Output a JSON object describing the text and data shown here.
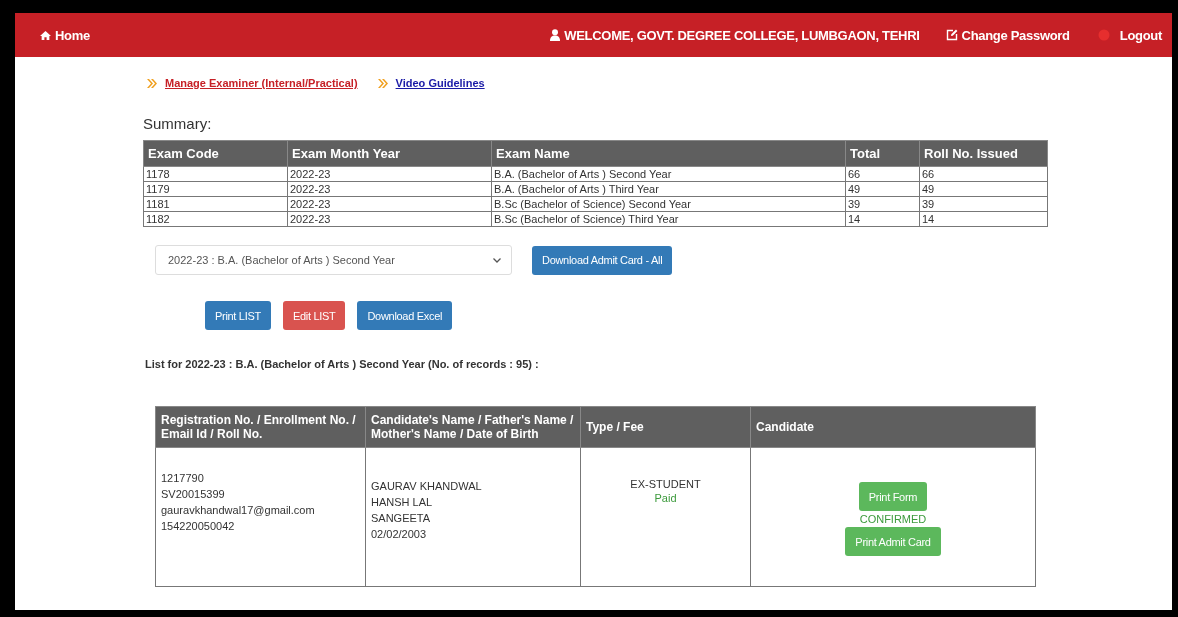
{
  "navbar": {
    "home": "Home",
    "welcome": "WELCOME, GOVT. DEGREE COLLEGE, LUMBGAON, TEHRI",
    "change_password": "Change Password",
    "logout": "Logout"
  },
  "links": [
    {
      "label": "Manage Examiner (Internal/Practical)",
      "kind": "danger"
    },
    {
      "label": "Video Guidelines",
      "kind": "primary"
    }
  ],
  "summary": {
    "title": "Summary:",
    "columns": [
      "Exam Code",
      "Exam Month Year",
      "Exam Name",
      "Total",
      "Roll No. Issued"
    ],
    "rows": [
      [
        "1178",
        "2022-23",
        "B.A. (Bachelor of Arts ) Second Year",
        "66",
        "66"
      ],
      [
        "1179",
        "2022-23",
        "B.A. (Bachelor of Arts ) Third Year",
        "49",
        "49"
      ],
      [
        "1181",
        "2022-23",
        "B.Sc (Bachelor of Science) Second Year",
        "39",
        "39"
      ],
      [
        "1182",
        "2022-23",
        "B.Sc (Bachelor of Science) Third Year",
        "14",
        "14"
      ]
    ]
  },
  "exam_select": {
    "value": "2022-23 : B.A. (Bachelor of Arts ) Second Year"
  },
  "download_all": {
    "label": "Download Admit Card - All",
    "kind": "primary"
  },
  "list_buttons": [
    {
      "label": "Print LIST",
      "kind": "primary"
    },
    {
      "label": "Edit LIST",
      "kind": "danger"
    },
    {
      "label": "Download Excel",
      "kind": "primary"
    }
  ],
  "list_title": "List for 2022-23 : B.A. (Bachelor of Arts ) Second Year (No. of records : 95) :",
  "candidates": {
    "columns": [
      "Registration No. / Enrollment No. / Email Id / Roll No.",
      "Candidate's Name / Father's Name / Mother's Name / Date of Birth",
      "Type / Fee",
      "Candidate"
    ],
    "rows": [
      {
        "ids": [
          "1217790",
          "SV20015399",
          "gauravkhandwal17@gmail.com",
          "154220050042"
        ],
        "names": [
          "GAURAV KHANDWAL",
          "HANSH LAL",
          "SANGEETA",
          "02/02/2003"
        ],
        "type": "EX-STUDENT",
        "fee": "Paid",
        "print_form": {
          "label": "Print Form",
          "kind": "success"
        },
        "status": "CONFIRMED",
        "print_admit": {
          "label": "Print Admit Card",
          "kind": "success"
        }
      }
    ]
  }
}
